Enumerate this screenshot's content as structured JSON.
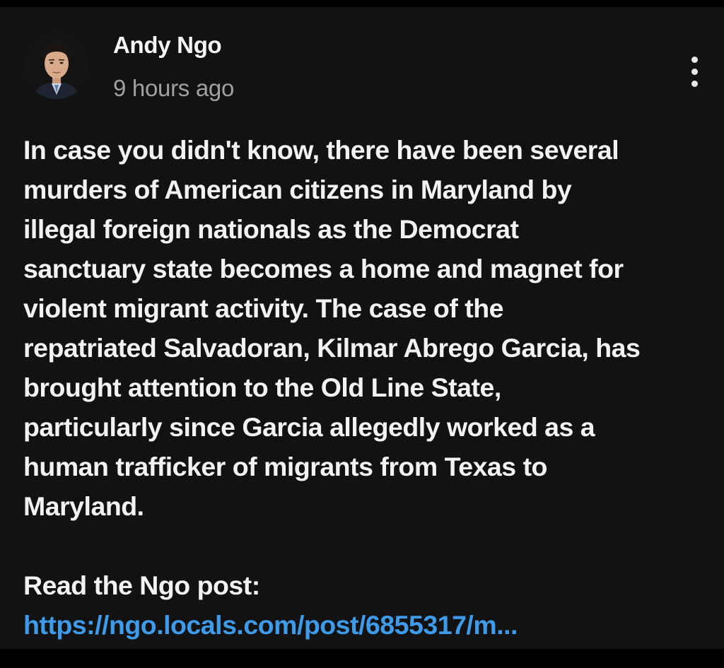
{
  "author": {
    "name": "Andy Ngo",
    "avatar_icon": "person-portrait-avatar"
  },
  "timestamp": "9 hours ago",
  "menu_icon": "vertical-ellipsis-icon",
  "post": {
    "lines": [
      "In case you didn't know, there have been several",
      "murders of American citizens in Maryland by",
      "illegal foreign nationals as the Democrat",
      "sanctuary state becomes a home and magnet for",
      "violent migrant activity. The case of the",
      "repatriated Salvadoran, Kilmar Abrego Garcia, has",
      "brought attention to the Old Line State,",
      "particularly since Garcia allegedly worked as a",
      "human trafficker of migrants from Texas to",
      "Maryland."
    ],
    "read_label": "Read the Ngo post:",
    "link_text": "https://ngo.locals.com/post/6855317/m..."
  },
  "colors": {
    "background": "#121212",
    "outer": "#000000",
    "text": "#f2f2f2",
    "muted": "#a0a0a0",
    "link": "#3d9be9"
  }
}
